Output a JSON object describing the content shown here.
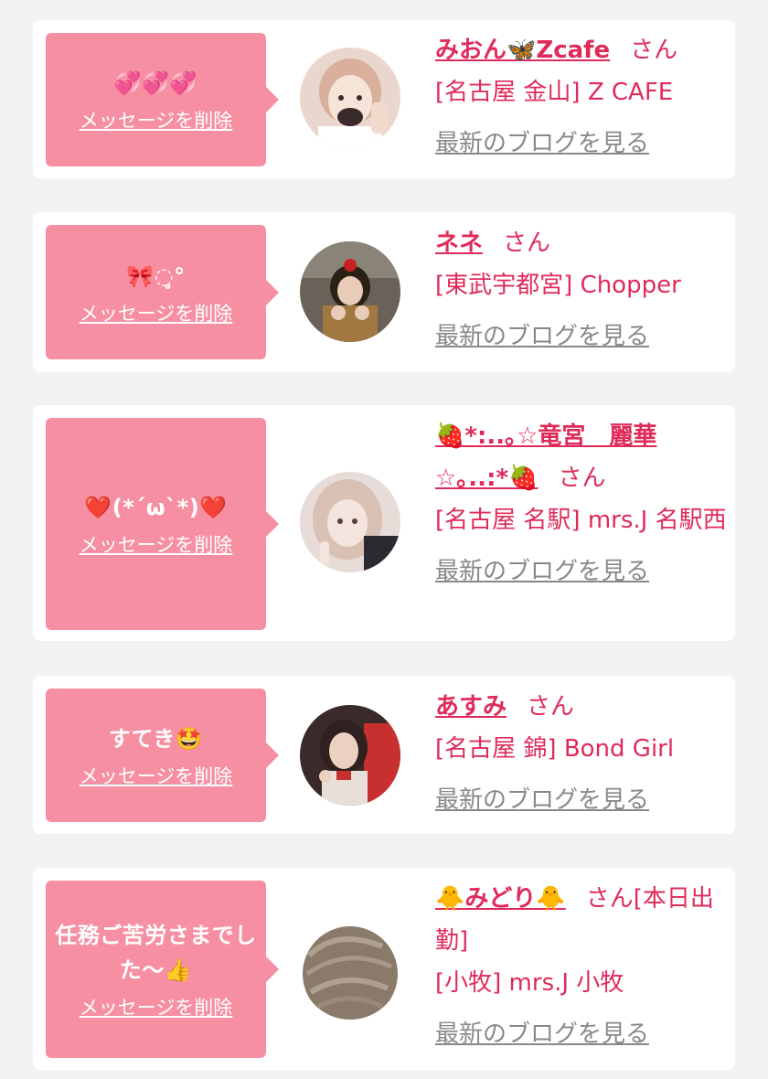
{
  "delete_label": "メッセージを削除",
  "blog_label": "最新のブログを見る",
  "honorific": "さん",
  "items": [
    {
      "message": "💞💞💞",
      "name": "みおん🦋Zcafe",
      "suffix": "",
      "shop": "[名古屋 金山] Z CAFE",
      "avatar_colors": [
        "#d9b8a8",
        "#f5e6dc",
        "#3a2b2b"
      ]
    },
    {
      "message": "🎀◌̥°",
      "name": "ネネ",
      "suffix": "",
      "shop": "[東武宇都宮] Chopper",
      "avatar_colors": [
        "#5a4a3a",
        "#a07840",
        "#2a2016"
      ]
    },
    {
      "message": "❤️(*´ω`*)❤️",
      "name": "🍓*:..｡☆竜宮　麗華☆｡..:*🍓",
      "suffix": "",
      "shop": "[名古屋 名駅] mrs.J 名駅西",
      "avatar_colors": [
        "#e8d8d4",
        "#c8b0a8",
        "#2a2a30"
      ]
    },
    {
      "message": "すてき🤩",
      "name": "あすみ",
      "suffix": "",
      "shop": "[名古屋 錦] Bond Girl",
      "avatar_colors": [
        "#c83030",
        "#e8c8b8",
        "#302020"
      ]
    },
    {
      "message": "任務ご苦労さまでした〜👍",
      "name": "🐥みどり🐥",
      "suffix": "[本日出勤]",
      "shop": "[小牧] mrs.J 小牧",
      "avatar_colors": [
        "#8a7a6a",
        "#b0a090",
        "#ffffff"
      ]
    }
  ]
}
